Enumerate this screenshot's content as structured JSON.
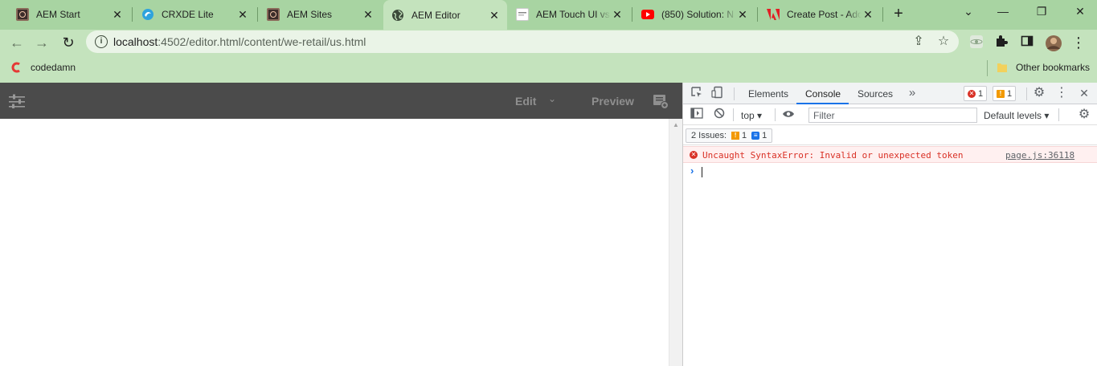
{
  "browser": {
    "tabs": [
      {
        "title": "AEM Start",
        "favicon": "aem-icon",
        "active": false
      },
      {
        "title": "CRXDE Lite",
        "favicon": "crxde-icon",
        "active": false
      },
      {
        "title": "AEM Sites",
        "favicon": "aem-icon",
        "active": false
      },
      {
        "title": "AEM Editor",
        "favicon": "globe-icon",
        "active": true
      },
      {
        "title": "AEM Touch UI vs",
        "favicon": "page-icon",
        "active": false
      },
      {
        "title": "(850) Solution: N",
        "favicon": "youtube-icon",
        "active": false
      },
      {
        "title": "Create Post - Ado",
        "favicon": "adobe-icon",
        "active": false
      }
    ],
    "new_tab_label": "+",
    "url_host": "localhost",
    "url_rest": ":4502/editor.html/content/we-retail/us.html",
    "bookmarks": [
      {
        "label": "codedamn",
        "icon": "codedamn-icon"
      }
    ],
    "other_bookmarks": "Other bookmarks",
    "theme_color": "#a8d4a2"
  },
  "aem": {
    "edit_label": "Edit",
    "preview_label": "Preview",
    "header_color": "#4b4b4b"
  },
  "devtools": {
    "tabs": [
      "Elements",
      "Console",
      "Sources"
    ],
    "active_tab": "Console",
    "error_count": "1",
    "warning_count": "1",
    "context": "top",
    "filter_placeholder": "Filter",
    "levels": "Default levels",
    "issues_label": "2 Issues:",
    "issues_warn": "1",
    "issues_info": "1",
    "console_messages": [
      {
        "level": "error",
        "text": "Uncaught SyntaxError: Invalid or unexpected token",
        "source": "page.js:36118"
      }
    ]
  }
}
